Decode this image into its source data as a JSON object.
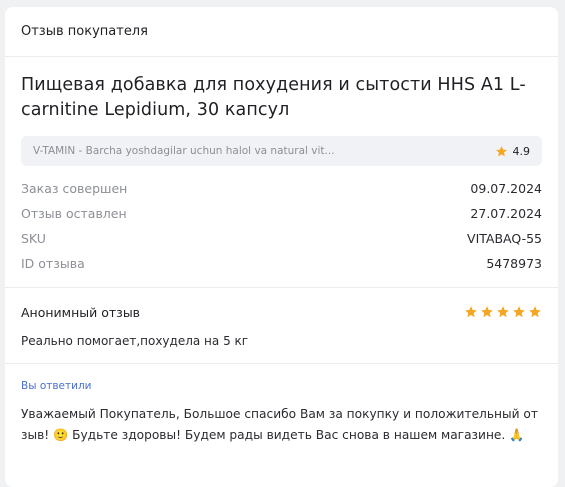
{
  "header": {
    "title": "Отзыв покупателя"
  },
  "product": {
    "title": "Пищевая добавка для похудения и сытости HHS A1 L-carnitine Lepidium, 30 капсул"
  },
  "shop": {
    "name": "V-TAMIN - Barcha yoshdagilar uchun halol va natural vit...",
    "rating": "4.9",
    "star_color": "#f5a623"
  },
  "details": [
    {
      "label": "Заказ совершен",
      "value": "09.07.2024"
    },
    {
      "label": "Отзыв оставлен",
      "value": "27.07.2024"
    },
    {
      "label": "SKU",
      "value": "VITABAQ-55"
    },
    {
      "label": "ID отзыва",
      "value": "5478973"
    }
  ],
  "review": {
    "author": "Анонимный отзыв",
    "rating": 5,
    "rating_max": 5,
    "text": "Реально помогает,похудела на 5 кг"
  },
  "reply": {
    "label": "Вы ответили",
    "text": "Уважаемый Покупатель, Большое спасибо Вам за покупку и положительный отзыв! 🙂 Будьте здоровы! Будем рады видеть Вас снова в нашем магазине. 🙏"
  },
  "colors": {
    "accent_link": "#4a6fd0",
    "star": "#f5a623"
  }
}
